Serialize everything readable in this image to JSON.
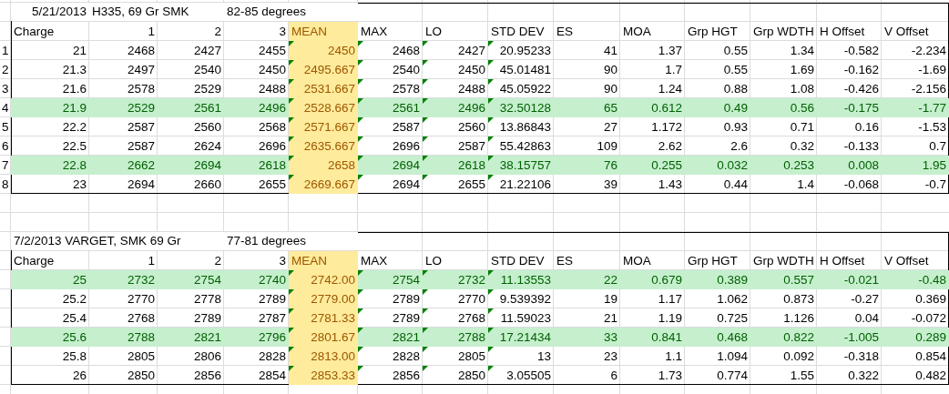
{
  "tables": [
    {
      "date": "5/21/2013",
      "title": "H335, 69 Gr SMK",
      "temperature": "82-85 degrees",
      "columns": [
        {
          "label": "Charge",
          "kind": "text",
          "highlighted": false,
          "flagged": false
        },
        {
          "label": "1",
          "kind": "number",
          "highlighted": false,
          "flagged": false
        },
        {
          "label": "2",
          "kind": "number",
          "highlighted": false,
          "flagged": false
        },
        {
          "label": "3",
          "kind": "number",
          "highlighted": false,
          "flagged": false
        },
        {
          "label": "MEAN",
          "kind": "text",
          "highlighted": true,
          "flagged": true
        },
        {
          "label": "MAX",
          "kind": "text",
          "highlighted": false,
          "flagged": true
        },
        {
          "label": "LO",
          "kind": "text",
          "highlighted": false,
          "flagged": true
        },
        {
          "label": "STD DEV",
          "kind": "text",
          "highlighted": false,
          "flagged": true
        },
        {
          "label": "ES",
          "kind": "text",
          "highlighted": false,
          "flagged": false
        },
        {
          "label": "MOA",
          "kind": "text",
          "highlighted": false,
          "flagged": false
        },
        {
          "label": "Grp HGT",
          "kind": "text",
          "highlighted": false,
          "flagged": false
        },
        {
          "label": "Grp WDTH",
          "kind": "text",
          "highlighted": false,
          "flagged": false
        },
        {
          "label": "H Offset",
          "kind": "text",
          "highlighted": false,
          "flagged": false
        },
        {
          "label": "V Offset",
          "kind": "text",
          "highlighted": false,
          "flagged": false
        }
      ],
      "rows": [
        {
          "number": "1",
          "highlighted": false,
          "cells": [
            "21",
            "2468",
            "2427",
            "2455",
            "2450",
            "2468",
            "2427",
            "20.95233",
            "41",
            "1.37",
            "0.55",
            "1.34",
            "-0.582",
            "-2.234"
          ]
        },
        {
          "number": "2",
          "highlighted": false,
          "cells": [
            "21.3",
            "2497",
            "2540",
            "2450",
            "2495.667",
            "2540",
            "2450",
            "45.01481",
            "90",
            "1.7",
            "0.55",
            "1.69",
            "-0.162",
            "-1.69"
          ]
        },
        {
          "number": "3",
          "highlighted": false,
          "cells": [
            "21.6",
            "2578",
            "2529",
            "2488",
            "2531.667",
            "2578",
            "2488",
            "45.05922",
            "90",
            "1.24",
            "0.88",
            "1.08",
            "-0.426",
            "-2.156"
          ]
        },
        {
          "number": "4",
          "highlighted": true,
          "cells": [
            "21.9",
            "2529",
            "2561",
            "2496",
            "2528.667",
            "2561",
            "2496",
            "32.50128",
            "65",
            "0.612",
            "0.49",
            "0.56",
            "-0.175",
            "-1.77"
          ]
        },
        {
          "number": "5",
          "highlighted": false,
          "cells": [
            "22.2",
            "2587",
            "2560",
            "2568",
            "2571.667",
            "2587",
            "2560",
            "13.86843",
            "27",
            "1.172",
            "0.93",
            "0.71",
            "0.16",
            "-1.53"
          ]
        },
        {
          "number": "6",
          "highlighted": false,
          "cells": [
            "22.5",
            "2587",
            "2624",
            "2696",
            "2635.667",
            "2696",
            "2587",
            "55.42863",
            "109",
            "2.62",
            "2.6",
            "0.32",
            "-0.133",
            "0.7"
          ]
        },
        {
          "number": "7",
          "highlighted": true,
          "cells": [
            "22.8",
            "2662",
            "2694",
            "2618",
            "2658",
            "2694",
            "2618",
            "38.15757",
            "76",
            "0.255",
            "0.032",
            "0.253",
            "0.008",
            "1.95"
          ]
        },
        {
          "number": "8",
          "highlighted": false,
          "cells": [
            "23",
            "2694",
            "2660",
            "2655",
            "2669.667",
            "2694",
            "2655",
            "21.22106",
            "39",
            "1.43",
            "0.44",
            "1.4",
            "-0.068",
            "-0.7"
          ]
        }
      ]
    },
    {
      "title": "7/2/2013 VARGET, SMK 69 Gr",
      "temperature": "77-81 degrees",
      "columns": [
        {
          "label": "Charge",
          "kind": "text",
          "highlighted": false,
          "flagged": false
        },
        {
          "label": "1",
          "kind": "number",
          "highlighted": false,
          "flagged": false
        },
        {
          "label": "2",
          "kind": "number",
          "highlighted": false,
          "flagged": false
        },
        {
          "label": "3",
          "kind": "number",
          "highlighted": false,
          "flagged": false
        },
        {
          "label": "MEAN",
          "kind": "text",
          "highlighted": true,
          "flagged": true
        },
        {
          "label": "MAX",
          "kind": "text",
          "highlighted": false,
          "flagged": true
        },
        {
          "label": "LO",
          "kind": "text",
          "highlighted": false,
          "flagged": true
        },
        {
          "label": "STD DEV",
          "kind": "text",
          "highlighted": false,
          "flagged": true
        },
        {
          "label": "ES",
          "kind": "text",
          "highlighted": false,
          "flagged": false
        },
        {
          "label": "MOA",
          "kind": "text",
          "highlighted": false,
          "flagged": false
        },
        {
          "label": "Grp HGT",
          "kind": "text",
          "highlighted": false,
          "flagged": false
        },
        {
          "label": "Grp WDTH",
          "kind": "text",
          "highlighted": false,
          "flagged": false
        },
        {
          "label": "H Offset",
          "kind": "text",
          "highlighted": false,
          "flagged": false
        },
        {
          "label": "V Offset",
          "kind": "text",
          "highlighted": false,
          "flagged": false
        }
      ],
      "rows": [
        {
          "highlighted": true,
          "cells": [
            "25",
            "2732",
            "2754",
            "2740",
            "2742.00",
            "2754",
            "2732",
            "11.13553",
            "22",
            "0.679",
            "0.389",
            "0.557",
            "-0.021",
            "-0.48"
          ]
        },
        {
          "highlighted": false,
          "cells": [
            "25.2",
            "2770",
            "2778",
            "2789",
            "2779.00",
            "2789",
            "2770",
            "9.539392",
            "19",
            "1.17",
            "1.062",
            "0.873",
            "-0.27",
            "0.369"
          ]
        },
        {
          "highlighted": false,
          "cells": [
            "25.4",
            "2768",
            "2789",
            "2787",
            "2781.33",
            "2789",
            "2768",
            "11.59023",
            "21",
            "1.19",
            "0.725",
            "1.126",
            "0.04",
            "-0.072"
          ]
        },
        {
          "highlighted": true,
          "cells": [
            "25.6",
            "2788",
            "2821",
            "2796",
            "2801.67",
            "2821",
            "2788",
            "17.21434",
            "33",
            "0.841",
            "0.468",
            "0.822",
            "-1.005",
            "0.289"
          ]
        },
        {
          "highlighted": false,
          "cells": [
            "25.8",
            "2805",
            "2806",
            "2828",
            "2813.00",
            "2828",
            "2805",
            "13",
            "23",
            "1.1",
            "1.094",
            "0.092",
            "-0.318",
            "0.854"
          ]
        },
        {
          "highlighted": false,
          "cells": [
            "26",
            "2850",
            "2856",
            "2854",
            "2853.33",
            "2856",
            "2850",
            "3.05505",
            "6",
            "1.73",
            "0.774",
            "1.55",
            "0.322",
            "0.482"
          ]
        }
      ]
    }
  ]
}
